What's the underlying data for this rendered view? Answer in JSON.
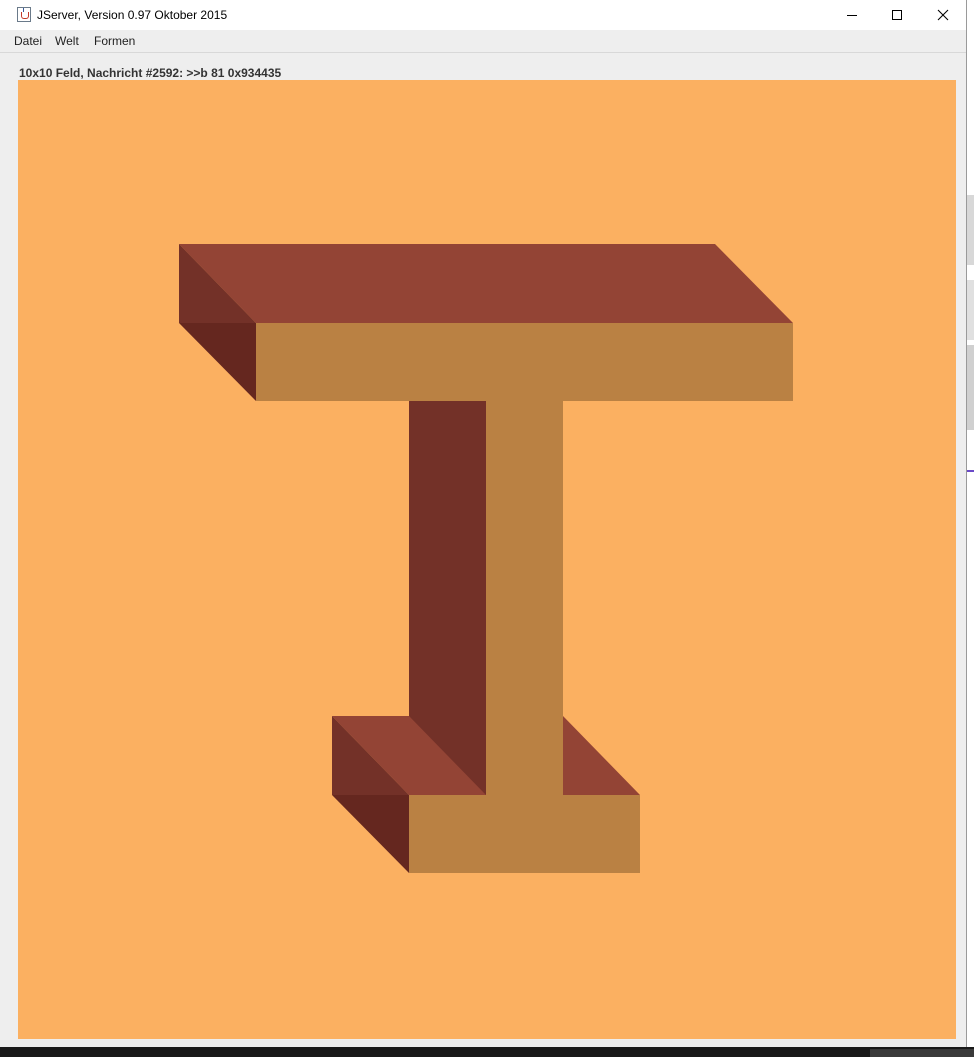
{
  "window": {
    "title": "JServer, Version 0.97 Oktober 2015",
    "controls": [
      "minimize-icon",
      "maximize-icon",
      "close-icon"
    ]
  },
  "menu": {
    "items": [
      "Datei",
      "Welt",
      "Formen"
    ]
  },
  "status": {
    "text": "10x10 Feld, Nachricht #2592: >>b 81 0x934435"
  },
  "board": {
    "size": "10x10",
    "background_color": "#fbb061",
    "shape": "T-shape (I-beam) drawn in 3D",
    "colors": {
      "top_face": "#934435",
      "front_face": "#ba8143",
      "side_face": "#733128",
      "dark_edge": "#65271f"
    }
  }
}
